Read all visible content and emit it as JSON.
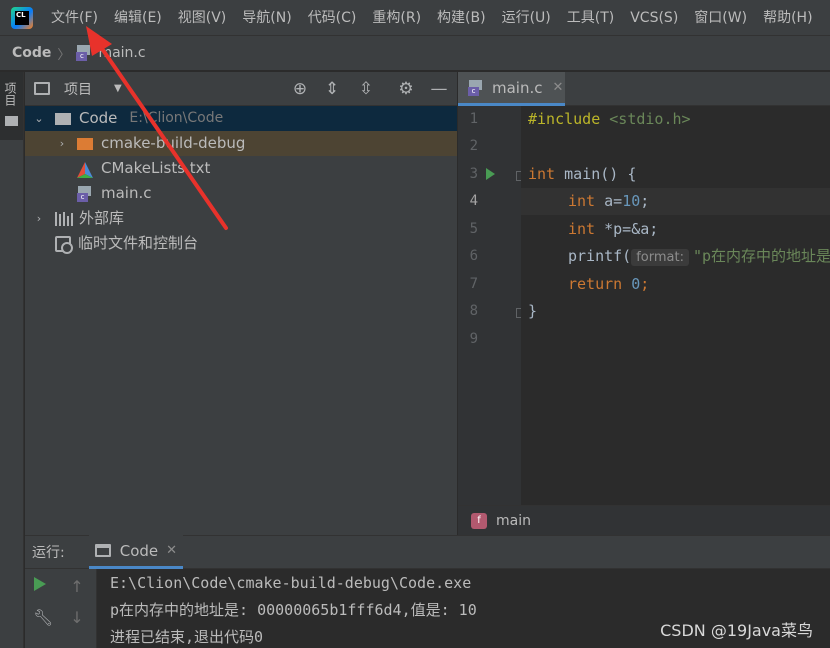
{
  "menubar": {
    "items": [
      "文件(F)",
      "编辑(E)",
      "视图(V)",
      "导航(N)",
      "代码(C)",
      "重构(R)",
      "构建(B)",
      "运行(U)",
      "工具(T)",
      "VCS(S)",
      "窗口(W)",
      "帮助(H)"
    ],
    "logo_text": "CL"
  },
  "breadcrumb": {
    "root": "Code",
    "file": "main.c",
    "file_lang": "c"
  },
  "left_strip": {
    "tab_label": "项目"
  },
  "project_panel": {
    "title": "项目",
    "tree": {
      "root_name": "Code",
      "root_path": "E:\\Clion\\Code",
      "items": [
        "cmake-build-debug",
        "CMakeLists.txt",
        "main.c"
      ],
      "external_libs": "外部库",
      "scratches": "临时文件和控制台"
    }
  },
  "editor": {
    "tab_label": "main.c",
    "line_numbers": [
      "1",
      "2",
      "3",
      "4",
      "5",
      "6",
      "7",
      "8",
      "9"
    ],
    "code": {
      "l1_pre": "#include",
      "l1_inc": " <stdio.h>",
      "l3_kw": "int",
      "l3_rest": " main() {",
      "l4_kw": "int",
      "l4_rest": " a=",
      "l4_num": "10",
      "l4_end": ";",
      "l5_kw": "int",
      "l5_rest": " *p=&a;",
      "l6_fn": "printf(",
      "l6_hint": "format:",
      "l6_str": "\"p在内存中的地址是：%p,值是：%d\\n\",p,*p);",
      "l7_kw": "return",
      "l7_num": " 0",
      "l7_end": ";",
      "l8": "}"
    },
    "footer_func": "main",
    "footer_icon": "f"
  },
  "run_panel": {
    "title": "运行:",
    "tab_label": "Code",
    "output": [
      "E:\\Clion\\Code\\cmake-build-debug\\Code.exe",
      "p在内存中的地址是: 00000065b1fff6d4,值是: 10",
      "进程已结束,退出代码0"
    ]
  },
  "watermark": "CSDN @19Java菜鸟",
  "colors": {
    "accent": "#4a88c7",
    "annotation_arrow": "#e8322b",
    "run_green": "#499c54"
  }
}
